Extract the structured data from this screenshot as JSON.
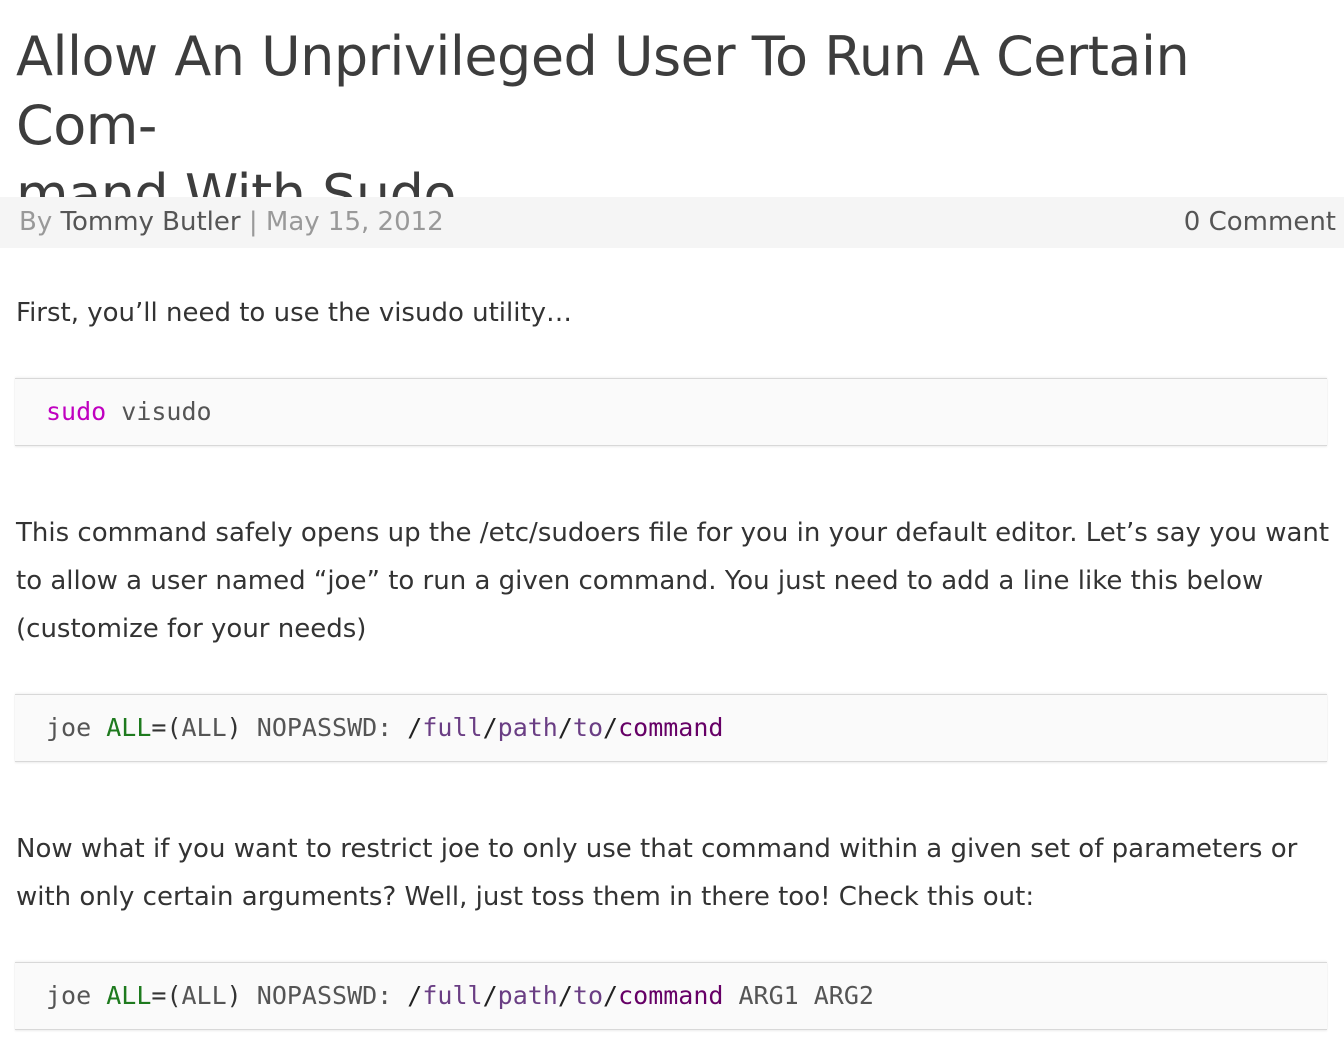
{
  "article": {
    "title": "Allow An Unprivileged User To Run A Certain Com-mand With Sudo",
    "title_line1": "Allow An Unprivileged User To Run A Certain Com-",
    "title_line2": "mand With Sudo",
    "meta": {
      "by": "By ",
      "author": "Tommy Butler",
      "separator": " | ",
      "date": "May 15, 2012",
      "comments": "0 Comment"
    },
    "paragraphs": [
      "First, you’ll need to use the visudo utility…",
      "This command safely opens up the /etc/sudoers file for you in your default editor. Let’s say you want to allow a user named “joe” to run a given command. You just need to add a line like this below (customize for your needs)",
      "Now what if you want to restrict joe to only use that command within a given set of parameters or with only certain arguments? Well, just toss them in there too! Check this out:"
    ],
    "code_blocks": [
      {
        "tokens": {
          "cmd": "sudo",
          "space": " ",
          "arg": "visudo"
        }
      },
      {
        "tokens": {
          "user": "joe ",
          "all1": "ALL",
          "eq": "=",
          "lparen": "(",
          "all2": "ALL",
          "rparen": ")",
          "nopasswd": " NOPASSWD: ",
          "slash1": "/",
          "full": "full",
          "slash2": "/",
          "path": "path",
          "slash3": "/",
          "to": "to",
          "slash4": "/",
          "command": "command"
        }
      },
      {
        "tokens": {
          "user": "joe ",
          "all1": "ALL",
          "eq": "=",
          "lparen": "(",
          "all2": "ALL",
          "rparen": ")",
          "nopasswd": " NOPASSWD: ",
          "slash1": "/",
          "full": "full",
          "slash2": "/",
          "path": "path",
          "slash3": "/",
          "to": "to",
          "slash4": "/",
          "command": "command",
          "args": " ARG1 ARG2"
        }
      }
    ]
  },
  "colors": {
    "sudo_keyword": "#c000c0",
    "all_keyword": "#1e7a1e",
    "path_segment": "#6a3e84",
    "command_segment": "#660066",
    "meta_background": "#f5f5f5",
    "code_background": "#fafafa"
  }
}
